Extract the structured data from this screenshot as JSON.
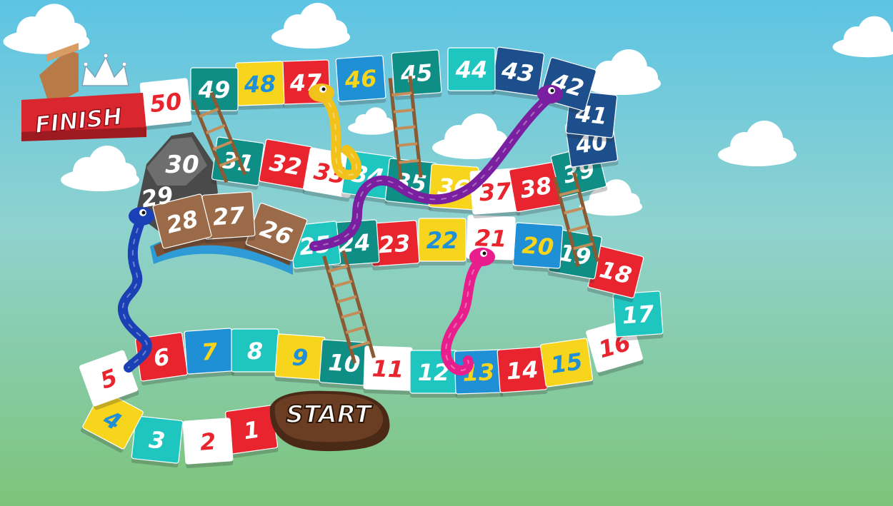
{
  "board": {
    "start_label": "START",
    "finish_label": "FINISH"
  },
  "tiles": [
    {
      "n": "1",
      "bg": "#e8252f",
      "fg": "#ffffff"
    },
    {
      "n": "2",
      "bg": "#ffffff",
      "fg": "#e8252f"
    },
    {
      "n": "3",
      "bg": "#1fc6c0",
      "fg": "#ffffff"
    },
    {
      "n": "4",
      "bg": "#f7d51c",
      "fg": "#1f8fd6"
    },
    {
      "n": "5",
      "bg": "#ffffff",
      "fg": "#e8252f"
    },
    {
      "n": "6",
      "bg": "#e8252f",
      "fg": "#ffffff"
    },
    {
      "n": "7",
      "bg": "#1f8fd6",
      "fg": "#f7d51c"
    },
    {
      "n": "8",
      "bg": "#1fc6c0",
      "fg": "#ffffff"
    },
    {
      "n": "9",
      "bg": "#f7d51c",
      "fg": "#1f8fd6"
    },
    {
      "n": "10",
      "bg": "#0f8e86",
      "fg": "#ffffff"
    },
    {
      "n": "11",
      "bg": "#ffffff",
      "fg": "#e8252f"
    },
    {
      "n": "12",
      "bg": "#1fc6c0",
      "fg": "#ffffff"
    },
    {
      "n": "13",
      "bg": "#1f8fd6",
      "fg": "#f7d51c"
    },
    {
      "n": "14",
      "bg": "#e8252f",
      "fg": "#ffffff"
    },
    {
      "n": "15",
      "bg": "#f7d51c",
      "fg": "#1f8fd6"
    },
    {
      "n": "16",
      "bg": "#ffffff",
      "fg": "#e8252f"
    },
    {
      "n": "17",
      "bg": "#1fc6c0",
      "fg": "#ffffff"
    },
    {
      "n": "18",
      "bg": "#e8252f",
      "fg": "#ffffff"
    },
    {
      "n": "19",
      "bg": "#0f8e86",
      "fg": "#ffffff"
    },
    {
      "n": "20",
      "bg": "#1f8fd6",
      "fg": "#f7d51c"
    },
    {
      "n": "21",
      "bg": "#ffffff",
      "fg": "#e8252f"
    },
    {
      "n": "22",
      "bg": "#f7d51c",
      "fg": "#1f8fd6"
    },
    {
      "n": "23",
      "bg": "#e8252f",
      "fg": "#ffffff"
    },
    {
      "n": "24",
      "bg": "#0f8e86",
      "fg": "#ffffff"
    },
    {
      "n": "25",
      "bg": "#1fc6c0",
      "fg": "#ffffff"
    },
    {
      "n": "26",
      "bg": "#9b6a48",
      "fg": "#ffffff"
    },
    {
      "n": "27",
      "bg": "#9b6a48",
      "fg": "#ffffff"
    },
    {
      "n": "28",
      "bg": "#9b6a48",
      "fg": "#ffffff"
    },
    {
      "n": "29",
      "bg": "#5c5c5c",
      "fg": "#ffffff"
    },
    {
      "n": "30",
      "bg": "#6d6d6d",
      "fg": "#ffffff"
    },
    {
      "n": "31",
      "bg": "#0f8e86",
      "fg": "#ffffff"
    },
    {
      "n": "32",
      "bg": "#e8252f",
      "fg": "#ffffff"
    },
    {
      "n": "33",
      "bg": "#ffffff",
      "fg": "#e8252f"
    },
    {
      "n": "34",
      "bg": "#1fc6c0",
      "fg": "#ffffff"
    },
    {
      "n": "35",
      "bg": "#0f8e86",
      "fg": "#ffffff"
    },
    {
      "n": "36",
      "bg": "#f7d51c",
      "fg": "#ffffff"
    },
    {
      "n": "37",
      "bg": "#ffffff",
      "fg": "#e8252f"
    },
    {
      "n": "38",
      "bg": "#e8252f",
      "fg": "#ffffff"
    },
    {
      "n": "39",
      "bg": "#0f8e86",
      "fg": "#ffffff"
    },
    {
      "n": "40",
      "bg": "#1d4f8c",
      "fg": "#ffffff"
    },
    {
      "n": "41",
      "bg": "#1d4f8c",
      "fg": "#ffffff"
    },
    {
      "n": "42",
      "bg": "#1d4f8c",
      "fg": "#ffffff"
    },
    {
      "n": "43",
      "bg": "#1d4f8c",
      "fg": "#ffffff"
    },
    {
      "n": "44",
      "bg": "#1fc6c0",
      "fg": "#ffffff"
    },
    {
      "n": "45",
      "bg": "#0f8e86",
      "fg": "#ffffff"
    },
    {
      "n": "46",
      "bg": "#1f8fd6",
      "fg": "#f7d51c"
    },
    {
      "n": "47",
      "bg": "#e8252f",
      "fg": "#ffffff"
    },
    {
      "n": "48",
      "bg": "#f7d51c",
      "fg": "#1f8fd6"
    },
    {
      "n": "49",
      "bg": "#0f8e86",
      "fg": "#ffffff"
    },
    {
      "n": "50",
      "bg": "#ffffff",
      "fg": "#e8252f"
    }
  ],
  "snakes": [
    {
      "name": "purple",
      "color": "#7a1fa0"
    },
    {
      "name": "yellow",
      "color": "#f2c21b"
    },
    {
      "name": "blue",
      "color": "#1b3fb5"
    },
    {
      "name": "pink",
      "color": "#e81e8c"
    }
  ],
  "colors": {
    "sky_top": "#5cc3e6",
    "grass_bottom": "#7dc47a"
  }
}
